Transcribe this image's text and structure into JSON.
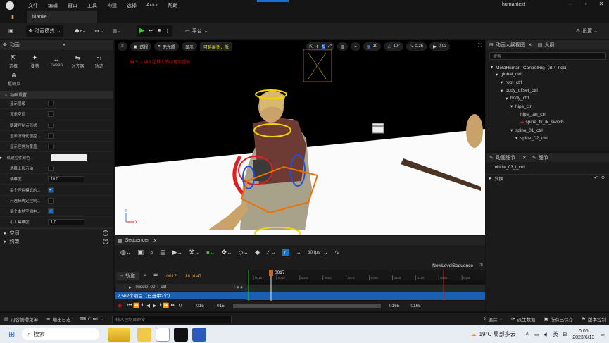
{
  "titlebar": {
    "menus": [
      "文件",
      "编辑",
      "窗口",
      "工具",
      "构建",
      "选择",
      "Actor",
      "帮助"
    ],
    "project_name": "humantext"
  },
  "tabs": {
    "doc_tab": "blanke"
  },
  "toolbar": {
    "mode": "动画模式",
    "platform": "平台",
    "settings": "设置"
  },
  "left_panel": {
    "title": "动画",
    "tools": [
      {
        "icon": "select-icon",
        "label": "选择"
      },
      {
        "icon": "pose-icon",
        "label": "姿势"
      },
      {
        "icon": "tween-icon",
        "label": "Tween"
      },
      {
        "icon": "mirror-icon",
        "label": "对齐器"
      },
      {
        "icon": "trail-icon",
        "label": "轨迹"
      }
    ],
    "extra_tool": "枢轴点",
    "section": "动画设置",
    "props": [
      {
        "label": "显示层级",
        "type": "check",
        "value": false
      },
      {
        "label": "显示空间",
        "type": "check",
        "value": false
      },
      {
        "label": "隐藏控制点形状",
        "type": "check",
        "value": false
      },
      {
        "label": "显示所有代理控...",
        "type": "check",
        "value": false
      },
      {
        "label": "显示控件为覆盖",
        "type": "check",
        "value": false
      },
      {
        "label": "轨迹控件颜色",
        "type": "color",
        "value": ""
      },
      {
        "label": "选择上影示轴",
        "type": "check",
        "value": false
      },
      {
        "label": "轴维度",
        "type": "num",
        "value": "10.0"
      },
      {
        "label": "每个控件模式的...",
        "type": "check",
        "value": true
      },
      {
        "label": "只选择绑定控制...",
        "type": "check",
        "value": false
      },
      {
        "label": "每个本地空间中...",
        "type": "check",
        "value": true
      },
      {
        "label": "小工具维度",
        "type": "num",
        "value": "1.0"
      }
    ],
    "groups": [
      "空间",
      "约束"
    ]
  },
  "viewport": {
    "btn_perspective": "透视",
    "btn_lit": "无光照",
    "btn_show": "显示",
    "scalability": "可延展性：低",
    "warning": "84.512 MiB 超算上的纹理流送池",
    "grid_snap": "10",
    "rot_snap": "10°",
    "scale_snap": "0.25",
    "cam_speed": "0.03"
  },
  "outliner": {
    "tab1": "动画大纲视图",
    "tab2": "大纲",
    "search_placeholder": "搜索",
    "items": [
      {
        "label": "MetaHuman_ControlRig（BP_ricci）",
        "indent": 0
      },
      {
        "label": "global_ctrl",
        "indent": 1
      },
      {
        "label": "root_ctrl",
        "indent": 2
      },
      {
        "label": "body_offset_ctrl",
        "indent": 2
      },
      {
        "label": "body_ctrl",
        "indent": 3
      },
      {
        "label": "hips_ctrl",
        "indent": 4
      },
      {
        "label": "hips_tan_ctrl",
        "indent": 5
      },
      {
        "label": "spine_fk_ik_switch",
        "indent": 5
      },
      {
        "label": "spine_01_ctrl",
        "indent": 4
      },
      {
        "label": "spine_02_ctrl",
        "indent": 5
      }
    ]
  },
  "details": {
    "tab1": "动画细节",
    "tab2": "细节",
    "selected": "middle_03_l_ctrl",
    "section": "变换"
  },
  "sequencer": {
    "title": "Sequencer",
    "fps": "30 fps",
    "sequence_name": "NewLevelSequence",
    "add_track": "轨道",
    "current_frame": "0017",
    "frame_count": "18 of 47",
    "playhead": "0017",
    "track_name": "middle_02_l_ctrl",
    "track_summary": "2,562个项目（已选中2个）",
    "range_start_a": "-015",
    "range_start_b": "-015",
    "range_end_a": "0165",
    "range_end_b": "0165",
    "ticks": [
      "0015",
      "0030",
      "0045",
      "0060",
      "0075",
      "0090",
      "0105",
      "0120",
      "0135",
      "0150"
    ]
  },
  "statusbar": {
    "drawer": "内容侧滑菜单",
    "log": "输出日志",
    "cmd": "Cmd",
    "cmd_placeholder": "输入控制台命令",
    "trace": "追踪",
    "derived": "派生数据",
    "saved": "所有已保存",
    "vcs": "版本控制"
  },
  "taskbar": {
    "search": "搜索",
    "weather": "19°C 局部多云",
    "ime": "英",
    "time": "0:05",
    "date": "2023/6/13"
  }
}
